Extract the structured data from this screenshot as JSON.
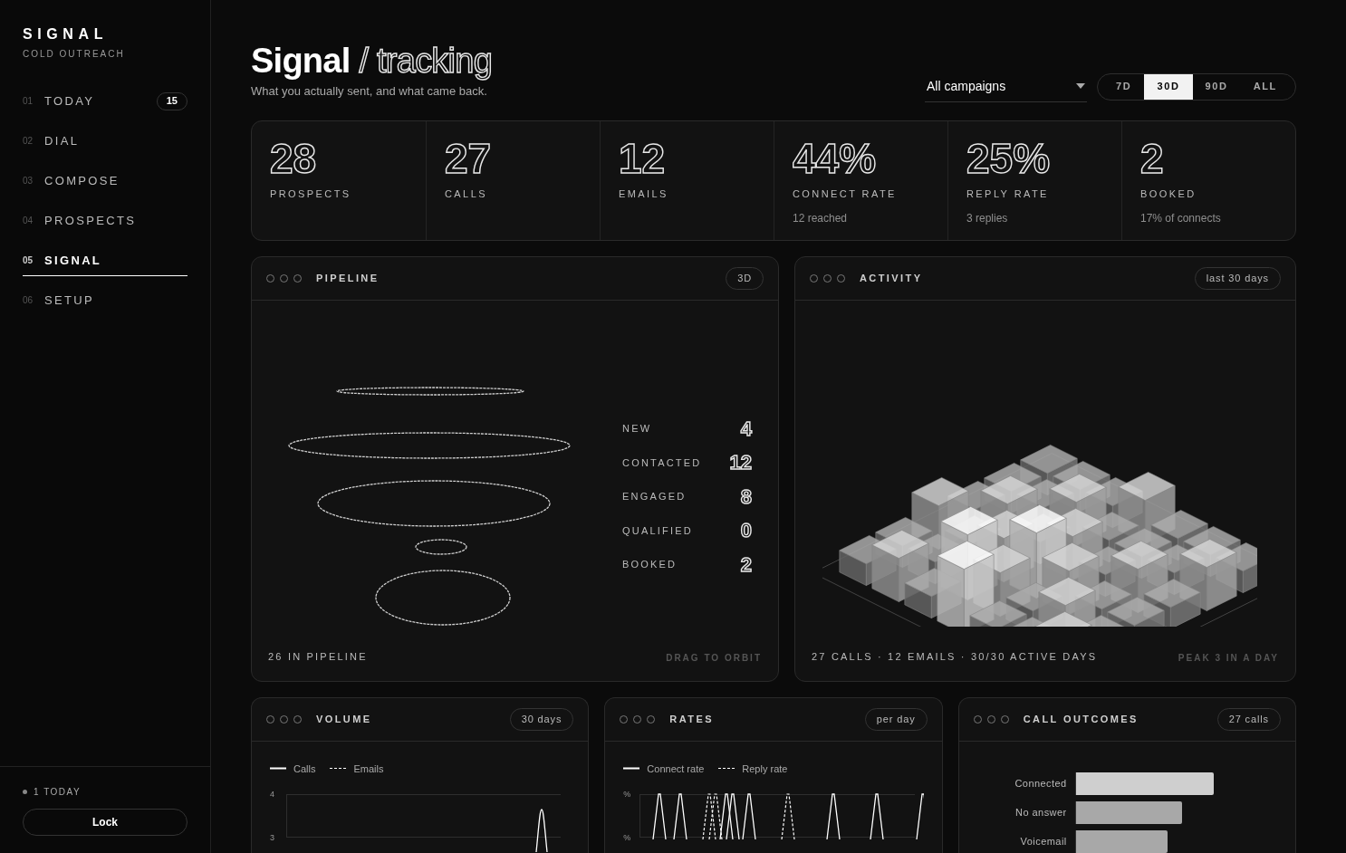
{
  "brand": {
    "name": "SIGNAL",
    "tagline": "COLD OUTREACH"
  },
  "nav": [
    {
      "num": "01",
      "label": "TODAY",
      "badge": "15",
      "selected": false
    },
    {
      "num": "02",
      "label": "DIAL",
      "selected": false
    },
    {
      "num": "03",
      "label": "COMPOSE",
      "selected": false
    },
    {
      "num": "04",
      "label": "PROSPECTS",
      "selected": false
    },
    {
      "num": "05",
      "label": "SIGNAL",
      "selected": true
    },
    {
      "num": "06",
      "label": "SETUP",
      "selected": false
    }
  ],
  "sidebar_footer": {
    "status": "1 TODAY",
    "lock_button": "Lock"
  },
  "header": {
    "title": "Signal",
    "title_accent": "/ tracking",
    "subtitle": "What you actually sent, and what came back.",
    "campaign_select": "All campaigns",
    "ranges": [
      {
        "label": "7D",
        "selected": false
      },
      {
        "label": "30D",
        "selected": true
      },
      {
        "label": "90D",
        "selected": false
      },
      {
        "label": "ALL",
        "selected": false
      }
    ]
  },
  "stats": [
    {
      "value": "28",
      "label": "PROSPECTS"
    },
    {
      "value": "27",
      "label": "CALLS"
    },
    {
      "value": "12",
      "label": "EMAILS"
    },
    {
      "value": "44%",
      "label": "CONNECT RATE",
      "sub": "12 reached"
    },
    {
      "value": "25%",
      "label": "REPLY RATE",
      "sub": "3 replies"
    },
    {
      "value": "2",
      "label": "BOOKED",
      "sub": "17% of connects"
    }
  ],
  "pipeline": {
    "title": "PIPELINE",
    "badge": "3D",
    "stages": [
      {
        "label": "NEW",
        "count": "4"
      },
      {
        "label": "CONTACTED",
        "count": "12"
      },
      {
        "label": "ENGAGED",
        "count": "8"
      },
      {
        "label": "QUALIFIED",
        "count": "0"
      },
      {
        "label": "BOOKED",
        "count": "2"
      }
    ],
    "footer": "26 IN PIPELINE",
    "hint": "DRAG TO ORBIT"
  },
  "activity": {
    "title": "ACTIVITY",
    "badge": "last 30 days",
    "footer": "27 CALLS · 12 EMAILS · 30/30 ACTIVE DAYS",
    "hint": "PEAK 3 IN A DAY"
  },
  "volume": {
    "title": "VOLUME",
    "badge": "30 days",
    "kind": "volume",
    "legend": [
      "Calls",
      "Emails"
    ],
    "axis_labels": [
      "4",
      "3"
    ]
  },
  "rates": {
    "title": "RATES",
    "badge": "per day",
    "kind": "rates",
    "legend": [
      "Connect rate",
      "Reply rate"
    ],
    "axis_labels": [
      "%",
      "%"
    ]
  },
  "outcomes": {
    "title": "CALL OUTCOMES",
    "badge": "27 calls",
    "bars": [
      {
        "label": "Connected",
        "level": 0.75
      },
      {
        "label": "No answer",
        "level": 0.58
      },
      {
        "label": "Voicemail",
        "level": 0.5
      }
    ]
  }
}
